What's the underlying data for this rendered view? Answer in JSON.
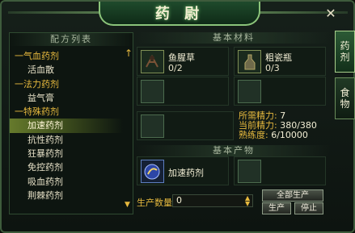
{
  "window": {
    "title": "药 尉"
  },
  "side_tabs": [
    {
      "label": "药\n剂"
    },
    {
      "label": "食\n物"
    }
  ],
  "left_panel": {
    "header": "配方列表",
    "rows": [
      {
        "type": "category",
        "label": "一气血药剂"
      },
      {
        "type": "item",
        "label": "活血散"
      },
      {
        "type": "category",
        "label": "一法力药剂"
      },
      {
        "type": "item",
        "label": "益气膏"
      },
      {
        "type": "category",
        "label": "一特殊药剂"
      },
      {
        "type": "item",
        "label": "加速药剂",
        "selected": true
      },
      {
        "type": "item",
        "label": "抗性药剂"
      },
      {
        "type": "item",
        "label": "狂暴药剂"
      },
      {
        "type": "item",
        "label": "免控药剂"
      },
      {
        "type": "item",
        "label": "吸血药剂"
      },
      {
        "type": "item",
        "label": "荆棘药剂"
      }
    ]
  },
  "materials": {
    "header": "基本材料",
    "slots": [
      {
        "name": "鱼腥草",
        "count": "0/2"
      },
      {
        "name": "粗瓷瓶",
        "count": "0/3"
      }
    ]
  },
  "stats": {
    "energy_label": "所需精力:",
    "energy_value": "7",
    "current_label": "当前精力:",
    "current_value": "380/380",
    "proficiency_label": "熟练度:",
    "proficiency_value": "6/10000"
  },
  "products": {
    "header": "基本产物",
    "item": {
      "name": "加速药剂"
    }
  },
  "production": {
    "qty_label": "生产数量",
    "qty_value": "0",
    "produce_all_label": "全部生产",
    "produce_label": "生产",
    "stop_label": "停止"
  }
}
